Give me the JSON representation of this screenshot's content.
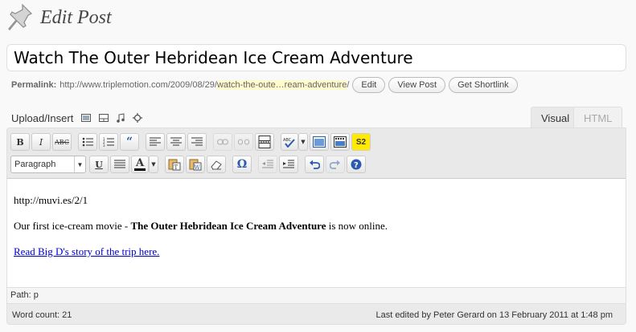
{
  "header": {
    "title": "Edit Post",
    "icon": "pushpin-icon"
  },
  "post": {
    "title": "Watch The Outer Hebridean Ice Cream Adventure"
  },
  "permalink": {
    "label": "Permalink:",
    "base": "http://www.triplemotion.com/2009/08/29/",
    "slug": "watch-the-oute…ream-adventure",
    "suffix": "/",
    "buttons": {
      "edit": "Edit",
      "view": "View Post",
      "shortlink": "Get Shortlink"
    }
  },
  "upload": {
    "label": "Upload/Insert",
    "icons": [
      "add-image-icon",
      "add-video-icon",
      "add-audio-icon",
      "add-media-icon"
    ]
  },
  "tabs": {
    "visual": "Visual",
    "html": "HTML"
  },
  "toolbar": {
    "bold": "B",
    "italic": "I",
    "strike": "ABC",
    "s2": "S2",
    "format_select": "Paragraph",
    "underline": "U",
    "special_char": "Ω",
    "text_color": "A"
  },
  "content": {
    "line1": "http://muvi.es/2/1",
    "line2_prefix": "Our first ice-cream movie - ",
    "line2_bold": "The Outer Hebridean Ice Cream Adventure",
    "line2_suffix": " is now online.",
    "link": "Read Big D's story of the trip here."
  },
  "path": {
    "text": "Path: p"
  },
  "status": {
    "word_count": "Word count: 21",
    "last_edited": "Last edited by Peter Gerard on 13 February 2011 at 1:48 pm"
  },
  "colors": {
    "slug_highlight": "#fffbcc",
    "s2_button": "#ffea00",
    "link": "#0000cc"
  }
}
